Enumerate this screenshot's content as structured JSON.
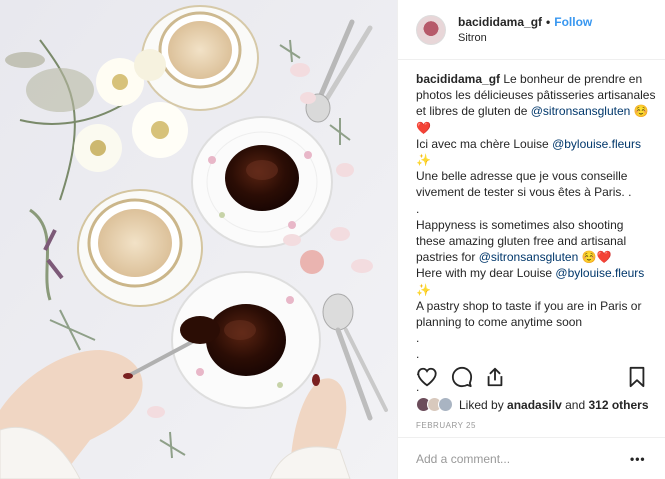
{
  "post": {
    "username": "bacididama_gf",
    "separator": "•",
    "follow_label": "Follow",
    "location": "Sitron"
  },
  "caption": {
    "username": "bacididama_gf",
    "line1_text": " Le bonheur de prendre en photos les délicieuses pâtisseries artisanales et libres de gluten de ",
    "mention1": "@sitronsansgluten",
    "emoji1": " ☺️❤️",
    "line2_text": "Ici avec ma chère Louise ",
    "mention2": "@bylouise.fleurs",
    "sparkle1": "✨",
    "line3_text": "Une belle adresse que je vous conseille vivement de tester si vous êtes à Paris. .",
    "dot_line": ".",
    "line4_text": "Happyness is sometimes also shooting these amazing gluten free and artisanal pastries for ",
    "mention3": "@sitronsansgluten",
    "emoji2": " ☺️❤️",
    "line5_text": "Here with my dear Louise ",
    "mention4": "@bylouise.fleurs",
    "sparkle2": "✨",
    "line6_text": "A pastry shop to taste if you are in Paris or planning to come anytime soon",
    "trailing_dots": [
      ".",
      ".",
      ".",
      "."
    ]
  },
  "icons": {
    "like": "heart-icon",
    "comment": "comment-bubble-icon",
    "share": "share-icon",
    "save": "bookmark-icon"
  },
  "likes": {
    "prefix": "Liked by ",
    "user": "anadasilv",
    "middle": " and ",
    "count": "312 others"
  },
  "date": "FEBRUARY 25",
  "comment_placeholder": "Add a comment...",
  "more_label": "•••"
}
